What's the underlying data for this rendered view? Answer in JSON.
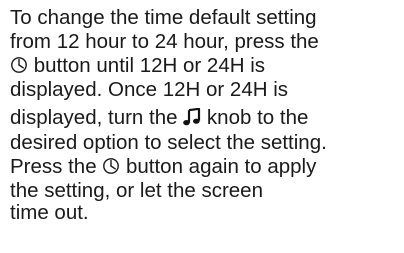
{
  "instruction": {
    "line1": "To change the time default setting",
    "line2": "from 12 hour to 24 hour, press the",
    "line3_after_icon": " button until 12H or 24H is",
    "line4": "displayed. Once 12H or 24H is",
    "line5_before_icon": "displayed, turn the ",
    "line5_after_icon": " knob to the",
    "line6": "desired option to select the setting.",
    "line7_before_icon": "Press the ",
    "line7_after_icon": " button again to apply",
    "line8": "the setting, or let the screen",
    "line9": "time out."
  },
  "icons": {
    "clock": "clock-icon",
    "music_note": "music-note-icon"
  }
}
